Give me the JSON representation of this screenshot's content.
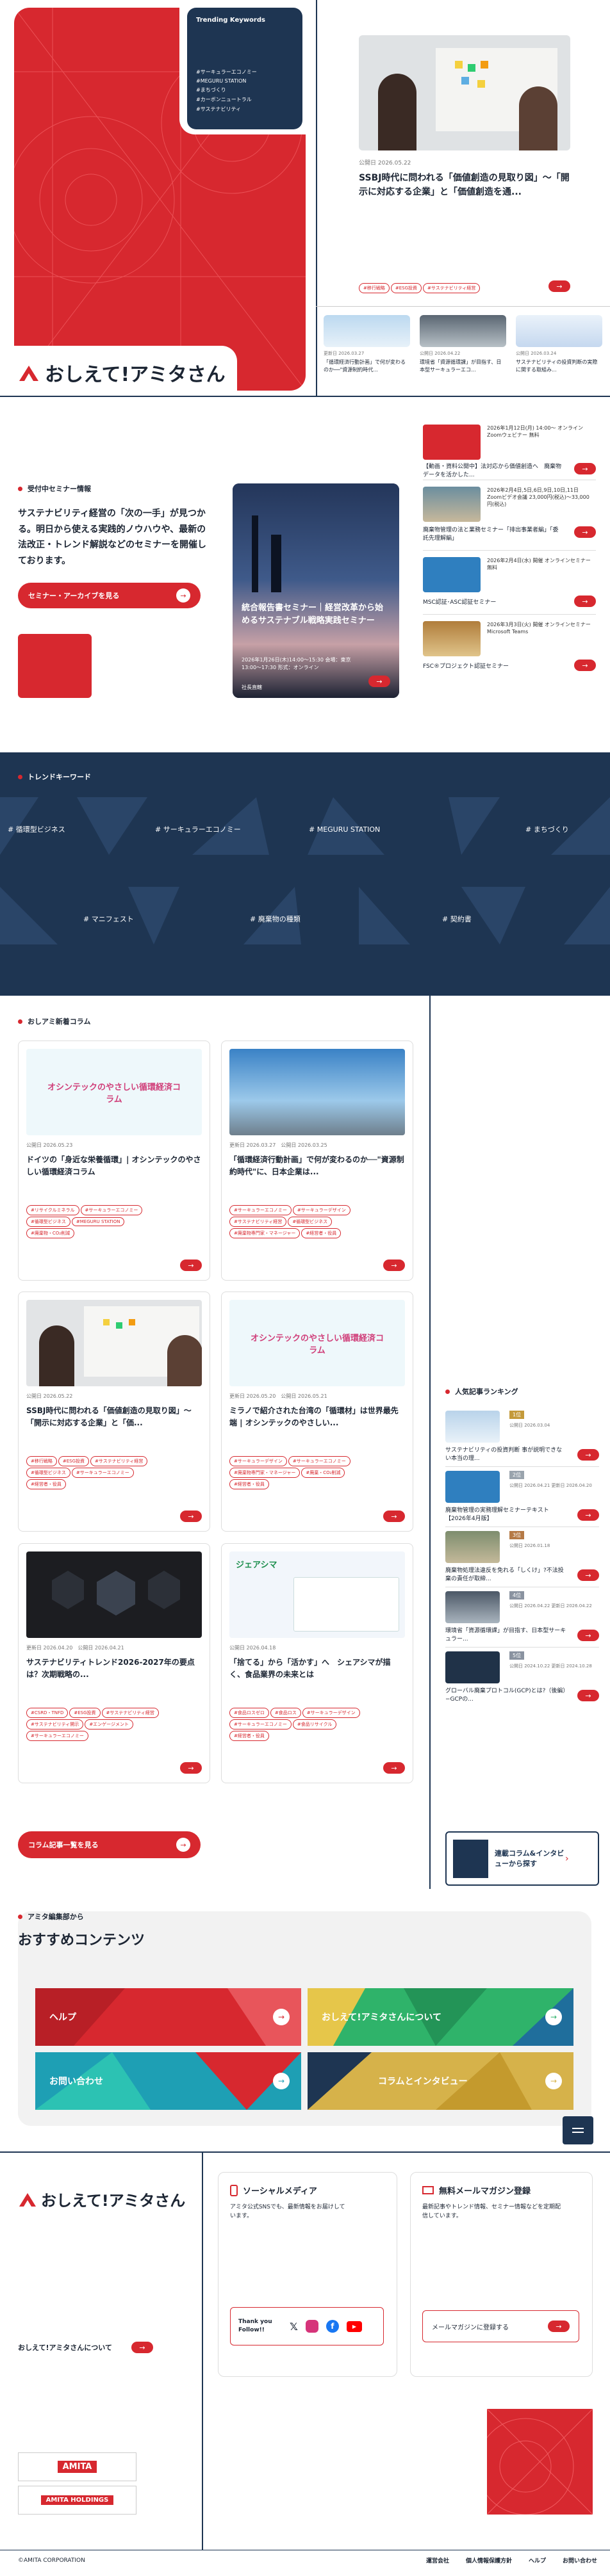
{
  "hero": {
    "trending_title": "Trending Keywords",
    "trending": [
      "#サーキュラーエコノミー",
      "#MEGURU STATION",
      "#まちづくり",
      "#カーボンニュートラル",
      "#サステナビリティ"
    ],
    "logo_text": "おしえて!アミタさん",
    "feature": {
      "date": "公開日 2026.05.22",
      "title": "SSBJ時代に問われる「価値創造の見取り図」〜「開示に対応する企業」と「価値創造を通...",
      "tags": [
        "#移行戦略",
        "#ESG投資",
        "#サステナビリティ経営"
      ]
    },
    "mini": [
      {
        "date": "更新日 2026.03.27",
        "title": "「循環経済行動計画」で何が変わるのか──\"資源制約時代..."
      },
      {
        "date": "公開日 2026.04.22",
        "title": "環境省「資源循環課」が目指す、日本型サーキュラーエコ..."
      },
      {
        "date": "公開日 2026.03.24",
        "title": "サステナビリティの投資判断の実際に関する取組み..."
      }
    ]
  },
  "seminar": {
    "label": "受付中セミナー情報",
    "desc": "サステナビリティ経営の「次の一手」が見つかる。明日から使える実践的ノウハウや、最新の法改正・トレンド解説などのセミナーを開催しております。",
    "archive_button": "セミナー・アーカイブを見る",
    "card": {
      "title": "統合報告書セミナー｜経営改革から始めるサステナブル戦略実践セミナー",
      "detail": "2026年1月26日(木)14:00〜15:30 会場：東京 13:00〜17:30 形式：オンライン",
      "extra": "社長直轄",
      "tag": "開催"
    },
    "list": [
      {
        "meta": "2026年1月12日(月) 14:00〜 オンライン Zoomウェビナー 無料",
        "title": "【動画・資料公開中】法対応から価値創造へ　廃棄物データを活かした..."
      },
      {
        "meta": "2026年2月4日,5日,6日,9日,10日,11日 Zoomビデオ会議 23,000円(税込)〜33,000円(税込)",
        "title": "廃棄物管理の法と業務セミナー「排出事業者編」「委託先理解編」"
      },
      {
        "meta": "2026年2月4日(水) 開催 オンラインセミナー 無料",
        "title": "MSC認証･ASC認証セミナー"
      },
      {
        "meta": "2026年3月3日(火) 開催 オンラインセミナー Microsoft Teams",
        "title": "FSC®プロジェクト認証セミナー"
      }
    ]
  },
  "trend": {
    "label": "トレンドキーワード",
    "row1": [
      "# 循環型ビジネス",
      "# サーキュラーエコノミー",
      "# MEGURU STATION",
      "# まちづくり"
    ],
    "row2": [
      "# マニフェスト",
      "# 廃棄物の種類",
      "# 契約書"
    ]
  },
  "column": {
    "label": "おしアミ新着コラム",
    "more_button": "コラム記事一覧を見る",
    "cards": [
      {
        "image_text": "オシンテックのやさしい循環経済コラム",
        "date": "公開日 2026.05.23",
        "title": "ドイツの「身近な栄養循環」| オシンテックのやさしい循環経済コラム",
        "tags": [
          "#リサイクルミネラル",
          "#サーキュラーエコノミー",
          "#循環型ビジネス",
          "#MEGURU STATION",
          "#廃棄物・CO₂削減",
          "#リサイクルミネラル"
        ]
      },
      {
        "image_text": "",
        "date": "更新日 2026.03.27　公開日 2026.03.25",
        "title": "「循環経済行動計画」で何が変わるのか──\"資源制約時代\"に、日本企業は...",
        "tags": [
          "#サーキュラーエコノミー",
          "#サーキュラーデザイン",
          "#サステナビリティ経営",
          "#循環型ビジネス",
          "#廃棄物専門家・マネージャー",
          "#経営者・役員",
          "#廃棄・CO₂削減",
          "#物流管理・配送"
        ]
      },
      {
        "image_text": "",
        "date": "公開日 2026.05.22",
        "title": "SSBJ時代に問われる「価値創造の見取り図」〜「開示に対応する企業」と「価...",
        "tags": [
          "#移行戦略",
          "#ESG投資",
          "#サステナビリティ経営",
          "#循環型ビジネス",
          "#サーキュラーエコノミー",
          "#経営者・役員",
          "#廃棄物専門家・マネージャー",
          "#経営者・役員"
        ]
      },
      {
        "image_text": "オシンテックのやさしい循環経済コラム",
        "date": "更新日 2026.05.20　公開日 2026.05.21",
        "title": "ミラノで紹介された台湾の「循環材」は世界最先端 | オシンテックのやさしい...",
        "tags": [
          "#サーキュラーデザイン",
          "#サーキュラーエコノミー",
          "#廃棄物専門家・マネージャー",
          "#廃棄・CO₂削減",
          "#経営者・役員"
        ]
      },
      {
        "image_text": "",
        "date": "更新日 2026.04.20　公開日 2026.04.21",
        "title": "サステナビリティトレンド2026-2027年の要点は？次期戦略の...",
        "tags": [
          "#CSRD・TNFD",
          "#ESG投資",
          "#サステナビリティ経営",
          "#サステナビリティ開示",
          "#エンゲージメント",
          "#サーキュラーエコノミー",
          "#気候変動",
          "#廃棄物専門家・マネージャー",
          "#経営者・役員"
        ]
      },
      {
        "image_text": "ジェアシマ",
        "date": "公開日 2026.04.18",
        "title": "「捨てる」から「活かす」へ　シェアシマが描く、食品業界の未来とは",
        "tags": [
          "#食品ロスゼロ",
          "#食品ロス",
          "#サーキュラーデザイン",
          "#サーキュラーエコノミー",
          "#食品リサイクル",
          "#経営者・役員",
          "#廃棄物専門家・マネージャー"
        ]
      }
    ]
  },
  "ranking": {
    "label": "人気記事ランキング",
    "items": [
      {
        "rank": "1位",
        "date": "公開日 2026.03.04",
        "title": "サステナビリティの投資判断 事が説明できない本当の理..."
      },
      {
        "rank": "2位",
        "date": "公開日 2026.04.21 更新日 2026.04.20",
        "title": "廃棄物管理の実務理解セミナーテキスト【2026年4月版】"
      },
      {
        "rank": "3位",
        "date": "公開日 2026.01.18",
        "title": "廃棄物処理法違反を免れる「しくけ」?不法投棄の責任が取締..."
      },
      {
        "rank": "4位",
        "date": "公開日 2026.04.22 更新日 2026.04.22",
        "title": "環境省「資源循環課」が目指す、日本型サーキュラー..."
      },
      {
        "rank": "5位",
        "date": "公開日 2024.10.22 更新日 2024.10.28",
        "title": "グローバル廃棄プロトコル(GCP)とは?（後編）−GCPの..."
      }
    ],
    "banner": "連載コラム&インタビューから探す"
  },
  "recommend": {
    "label": "アミタ編集部から",
    "heading": "おすすめコンテンツ",
    "tiles": [
      {
        "label": "ヘルプ",
        "color": "#d7282f"
      },
      {
        "label": "おしえて!アミタさんについて",
        "color": "#2fb36a"
      },
      {
        "label": "お問い合わせ",
        "color": "#1e9fb4"
      },
      {
        "label": "コラムとインタビュー",
        "color": "#d6b24a"
      }
    ]
  },
  "footer": {
    "logo_text": "おしえて!アミタさん",
    "about_link": "おしえて!アミタさんについて",
    "social": {
      "title": "ソーシャルメディア",
      "desc": "アミタ公式SNSでも、最新情報をお届けしています。",
      "thanks": "Thank you Follow!!"
    },
    "mail": {
      "title": "無料メールマガジン登録",
      "desc": "最新記事やトレンド情報、セミナー情報などを定期配信しています。",
      "button": "メールマガジンに登録する"
    },
    "logo1": "AMITA",
    "logo2": "AMITA HOLDINGS",
    "copyright": "©AMITA CORPORATION",
    "links": [
      "運営会社",
      "個人情報保護方針",
      "ヘルプ",
      "お問い合わせ"
    ]
  }
}
